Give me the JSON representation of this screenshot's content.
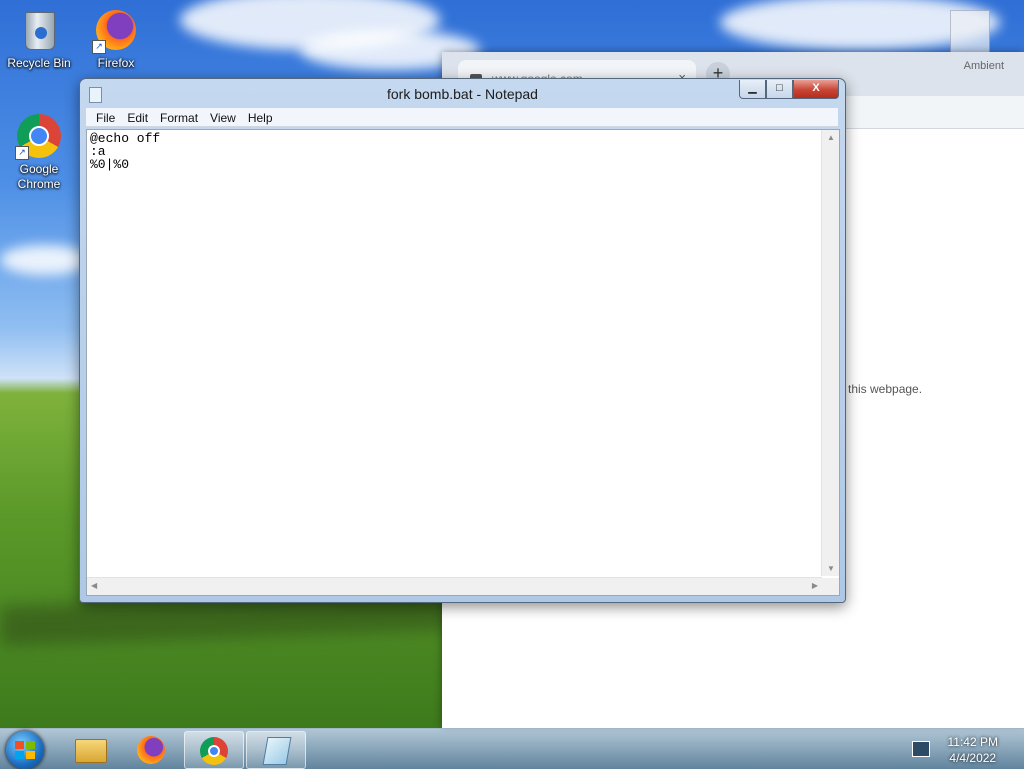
{
  "desktop": {
    "icons": [
      {
        "label": "Recycle Bin",
        "icon": "recycle-bin-icon"
      },
      {
        "label": "Firefox",
        "icon": "firefox-icon"
      },
      {
        "label": "Google Chrome",
        "icon": "chrome-icon"
      }
    ]
  },
  "chrome_window": {
    "tab_title": "www.google.com",
    "tab_close": "×",
    "new_tab": "+",
    "side_label": "Ambient",
    "message_fragment": "g this webpage."
  },
  "notepad": {
    "title": "fork bomb.bat - Notepad",
    "controls": {
      "minimize": "▁",
      "maximize": "□",
      "close": "X"
    },
    "menu": [
      "File",
      "Edit",
      "Format",
      "View",
      "Help"
    ],
    "content": "@echo off\n:a\n%0|%0"
  },
  "taskbar": {
    "pinned": [
      "windows-explorer-icon",
      "firefox-icon",
      "chrome-icon",
      "notepad-icon"
    ],
    "active": "notepad",
    "clock_time": "11:42 PM",
    "clock_date": "4/4/2022"
  },
  "colors": {
    "titlebar": "#b7cfea",
    "close_button": "#c84535",
    "taskbar": "#5b8aa8"
  }
}
